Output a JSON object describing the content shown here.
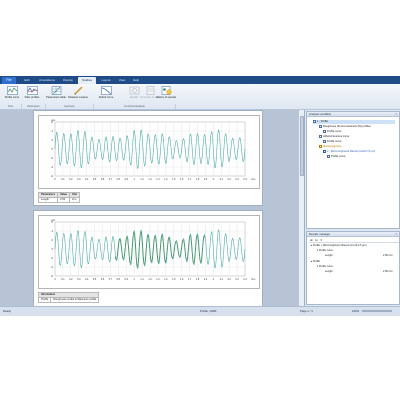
{
  "tabs": {
    "file": "File",
    "items": [
      "Edit",
      "Annotations",
      "Display",
      "Studies",
      "Layout",
      "View",
      "Help"
    ],
    "active_index": 3
  },
  "ribbon": {
    "buttons": [
      {
        "label": "Profile curve",
        "icon": "profile-curve-icon"
      },
      {
        "label": "Filter profiles",
        "icon": "filter-icon"
      },
      {
        "label": "Parameters table",
        "icon": "parameters-table-icon"
      },
      {
        "label": "Distance measurement",
        "icon": "distance-measure-icon"
      },
      {
        "label": "Abbott curve",
        "icon": "abbott-curve-icon"
      },
      {
        "label": "Identify",
        "icon": "identify-icon"
      },
      {
        "label": "Summary of operations",
        "icon": "summary-icon"
      },
      {
        "label": "History of operation",
        "icon": "history-icon"
      }
    ],
    "groups": [
      "View",
      "Parameters",
      "Geometry",
      "Functional analysis"
    ]
  },
  "chart1": {
    "unit_label": "µm",
    "y_ticks": [
      "6",
      "4",
      "2",
      "0",
      "-2",
      "-4",
      "-6"
    ],
    "x_ticks": [
      "0",
      "0.1",
      "0.2",
      "0.3",
      "0.4",
      "0.5",
      "0.6",
      "0.7",
      "0.8",
      "0.9",
      "1",
      "1.1",
      "1.2",
      "1.3",
      "1.4",
      "1.5",
      "1.6",
      "1.7",
      "1.8",
      "1.9",
      "2",
      "2.1",
      "2.2",
      "2.3",
      "2.4"
    ],
    "x_unit": "mm",
    "color": "#3fa8a0"
  },
  "table1": {
    "header": [
      "Parameters",
      "Value",
      "Unit"
    ],
    "rows": [
      [
        "Length",
        "2.50",
        "mm"
      ]
    ]
  },
  "chart2": {
    "unit_label": "µm",
    "y_ticks": [
      "6",
      "4",
      "2",
      "0",
      "-2",
      "-4",
      "-6"
    ],
    "x_ticks": [
      "0",
      "0.1",
      "0.2",
      "0.3",
      "0.4",
      "0.5",
      "0.6",
      "0.7",
      "0.8",
      "0.9",
      "1",
      "1.1",
      "1.2",
      "1.3",
      "1.4",
      "1.5",
      "1.6",
      "1.7",
      "1.8",
      "1.9",
      "2",
      "2.1",
      "2.2",
      "2.3",
      "2.4"
    ],
    "x_unit": "mm",
    "color": "#3fa8a0",
    "overlay_color": "#2e7d32"
  },
  "table2": {
    "header": [
      "Information"
    ],
    "rows": [
      [
        "Profile",
        "Roughness profile & Waviness profile"
      ]
    ]
  },
  "workflow_panel": {
    "title": "Analysis workflow",
    "nodes": [
      "1 - Profile",
      "Roughness (R) and waviness (W) profiles",
      "Profile curve",
      "Abbott-Firestone curve",
      "Microroughness",
      "2 - Microroughness filtered (cutoff 2.5 µm)",
      "Profile curve"
    ]
  },
  "results_panel": {
    "title": "Results manager",
    "rows": [
      {
        "text": "Profile > Microroughness filtered (cut-off 2.5 µm)",
        "value": ""
      },
      {
        "text": "Profile curve",
        "value": ""
      },
      {
        "text": "Length",
        "value": "2.50 mm"
      },
      {
        "text": "Profile",
        "value": ""
      },
      {
        "text": "Profile curve",
        "value": ""
      },
      {
        "text": "Length",
        "value": "2.50 mm"
      }
    ]
  },
  "statusbar": {
    "left": "Ready",
    "center": "Profile | 2084",
    "page": "Page 1 / 1",
    "zoom": "100%"
  }
}
